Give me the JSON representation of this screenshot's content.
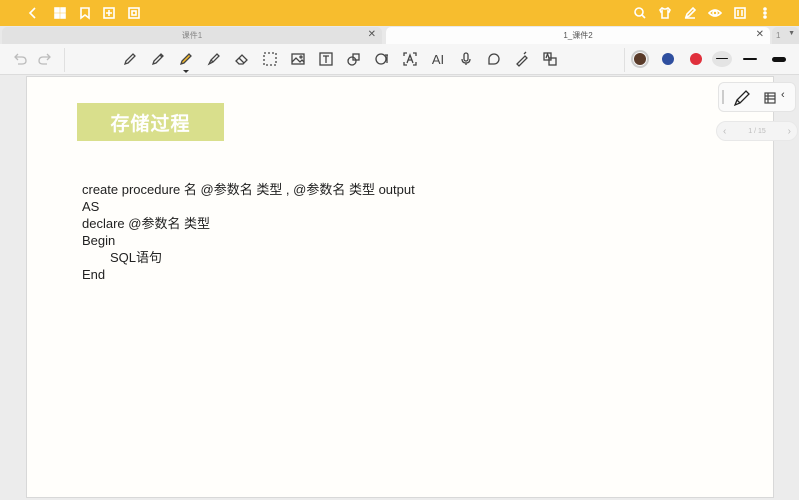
{
  "window": {
    "tabs": [
      {
        "label": "课件1"
      },
      {
        "label": "1_课件2"
      },
      {
        "label": "1"
      }
    ]
  },
  "topbar": {
    "left_icons": [
      "back-icon",
      "grid-icon",
      "bookmark-icon",
      "add-page-icon",
      "crop-icon"
    ],
    "right_icons": [
      "search-icon",
      "shirt-icon",
      "pen-edit-icon",
      "eye-icon",
      "reader-icon",
      "more-icon"
    ]
  },
  "toolbar": {
    "tools": [
      "undo-icon",
      "redo-icon",
      "fountain-pen-icon",
      "pencil-icon",
      "highlighter-icon",
      "marker-icon",
      "eraser-icon",
      "lasso-icon",
      "image-icon",
      "textbox-icon",
      "shape-icon",
      "ocr-icon",
      "text-recognition-icon",
      "ai-icon",
      "mic-icon",
      "sticker-icon",
      "laser-icon",
      "translate-icon"
    ],
    "ai_label": "AI",
    "colors": [
      "#5a3b2a",
      "#2f4f9f",
      "#e0303c"
    ]
  },
  "page": {
    "title": "存储过程",
    "code_lines": [
      "create procedure 名 @参数名 类型 , @参数名 类型 output",
      "AS",
      "declare @参数名 类型",
      "Begin",
      "SQL语句",
      "End"
    ]
  },
  "pager": {
    "text": "1 / 15"
  }
}
